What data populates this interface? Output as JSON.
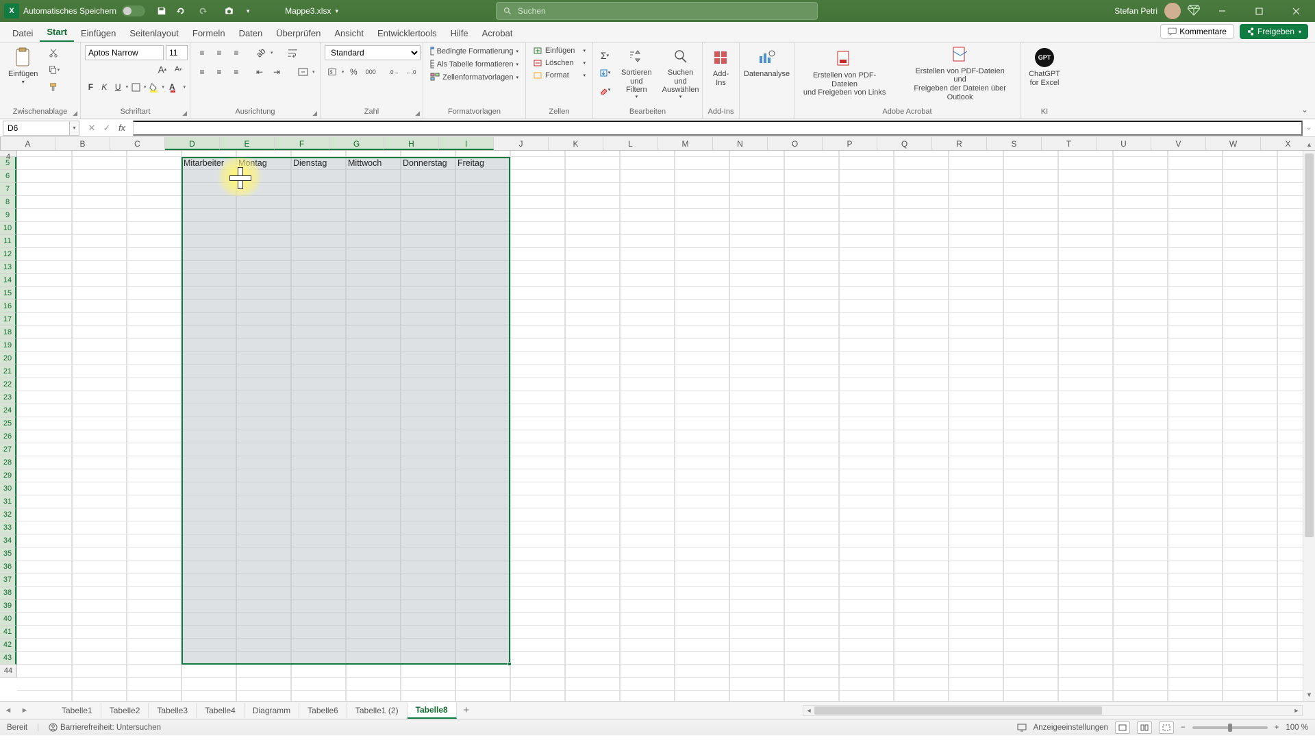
{
  "title": {
    "excel_letter": "X",
    "autosave": "Automatisches Speichern",
    "docname": "Mappe3.xlsx",
    "search_placeholder": "Suchen",
    "username": "Stefan Petri"
  },
  "menutabs": {
    "file": "Datei",
    "start": "Start",
    "einfugen": "Einfügen",
    "seitenlayout": "Seitenlayout",
    "formeln": "Formeln",
    "daten": "Daten",
    "uberprufen": "Überprüfen",
    "ansicht": "Ansicht",
    "entwickler": "Entwicklertools",
    "hilfe": "Hilfe",
    "acrobat": "Acrobat",
    "kommentare": "Kommentare",
    "freigeben": "Freigeben"
  },
  "ribbon": {
    "einfugen": "Einfügen",
    "zwischenablage": "Zwischenablage",
    "font_name": "Aptos Narrow",
    "font_size": "11",
    "schriftart": "Schriftart",
    "ausrichtung": "Ausrichtung",
    "numberformat": "Standard",
    "zahl": "Zahl",
    "bedingte": "Bedingte Formatierung",
    "alstabelle": "Als Tabelle formatieren",
    "zellenvorlagen": "Zellenformatvorlagen",
    "formatvorlagen": "Formatvorlagen",
    "zeinfugen": "Einfügen",
    "loeschen": "Löschen",
    "format": "Format",
    "zellen": "Zellen",
    "sortieren": "Sortieren und\nFiltern",
    "suchen": "Suchen und\nAuswählen",
    "bearbeiten": "Bearbeiten",
    "addins": "Add-\nIns",
    "addins_lbl": "Add-Ins",
    "datenanalyse": "Datenanalyse",
    "pdf1": "Erstellen von PDF-Dateien\nund Freigeben von Links",
    "pdf2": "Erstellen von PDF-Dateien und\nFreigeben der Dateien über Outlook",
    "adobe": "Adobe Acrobat",
    "chatgpt": "ChatGPT\nfor Excel",
    "ki": "KI",
    "bold": "F",
    "italic": "K",
    "underline": "U"
  },
  "namebox": "D6",
  "columns": [
    "A",
    "B",
    "C",
    "D",
    "E",
    "F",
    "G",
    "H",
    "I",
    "J",
    "K",
    "L",
    "M",
    "N",
    "O",
    "P",
    "Q",
    "R",
    "S",
    "T",
    "U",
    "V",
    "W",
    "X"
  ],
  "headers": {
    "d5": "Mitarbeiter",
    "e5": "Montag",
    "f5": "Dienstag",
    "g5": "Mittwoch",
    "h5": "Donnerstag",
    "i5": "Freitag"
  },
  "sheets": {
    "t1": "Tabelle1",
    "t2": "Tabelle2",
    "t3": "Tabelle3",
    "t4": "Tabelle4",
    "dia": "Diagramm",
    "t6": "Tabelle6",
    "t1b": "Tabelle1 (2)",
    "t8": "Tabelle8"
  },
  "status": {
    "bereit": "Bereit",
    "barriere": "Barrierefreiheit: Untersuchen",
    "anzeige": "Anzeigeeinstellungen",
    "zoom": "100 %"
  }
}
